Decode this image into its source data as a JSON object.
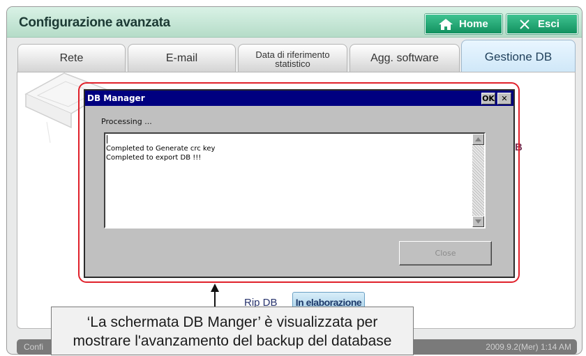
{
  "app": {
    "title": "Configurazione avanzata",
    "home_label": "Home",
    "exit_label": "Esci"
  },
  "tabs": [
    {
      "label": "Rete"
    },
    {
      "label": "E-mail"
    },
    {
      "label_line1": "Data di riferimento",
      "label_line2": "statistico"
    },
    {
      "label": "Agg. software"
    },
    {
      "label": "Gestione DB",
      "selected": true
    }
  ],
  "background": {
    "partial_letter": "B",
    "rip_db_label": "Rip DB",
    "in_progress_label": "In elaborazione"
  },
  "footer": {
    "left_text": "Confi",
    "datetime": "2009.9.2(Mer)  1:14 AM"
  },
  "dialog": {
    "title": "DB Manager",
    "ok_label": "OK",
    "close_x": "✕",
    "status_text": "Processing ...",
    "log_lines": [
      "Completed to Generate crc key",
      "Completed to export DB !!!"
    ],
    "close_button_label": "Close",
    "close_button_enabled": false
  },
  "annotation": {
    "line1": "‘La schermata DB Manger’ è visualizzata per",
    "line2": "mostrare l'avanzamento del backup del database",
    "highlight_color": "#e0202a"
  },
  "colors": {
    "header_accent": "#12915f",
    "dialog_titlebar": "#000080"
  },
  "icons": {
    "home": "home-icon",
    "exit": "close-icon",
    "arrow": "arrow-up-icon"
  }
}
